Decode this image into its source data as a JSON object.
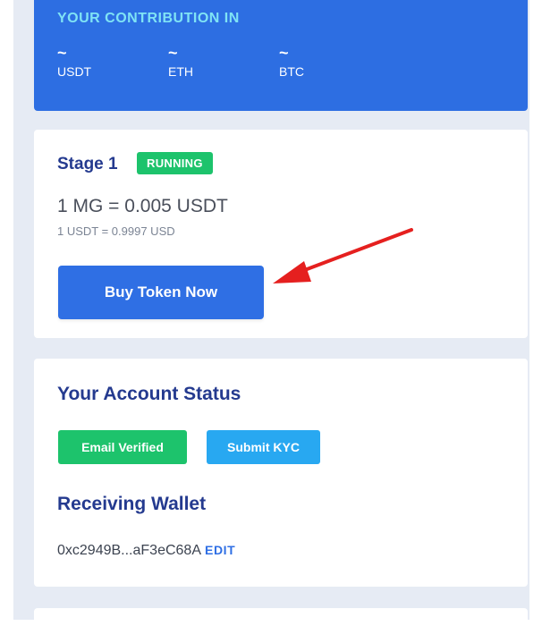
{
  "contribution": {
    "title": "YOUR CONTRIBUTION IN",
    "currencies": [
      {
        "amount": "~",
        "label": "USDT"
      },
      {
        "amount": "~",
        "label": "ETH"
      },
      {
        "amount": "~",
        "label": "BTC"
      }
    ]
  },
  "stage": {
    "title": "Stage 1",
    "status": "RUNNING",
    "price": "1 MG = 0.005 USDT",
    "rate": "1 USDT = 0.9997 USD",
    "buy_label": "Buy Token Now"
  },
  "account": {
    "title": "Your Account Status",
    "email_label": "Email Verified",
    "kyc_label": "Submit KYC",
    "wallet_title": "Receiving Wallet",
    "wallet_address": "0xc2949B...aF3eC68A",
    "edit_label": "EDIT"
  },
  "colors": {
    "accent": "#2f6fe4",
    "contrib_bg": "#2d6ee2",
    "heading": "#243a8f",
    "success": "#1dc36c",
    "info": "#28a8f1",
    "annotation_arrow": "#e5201f"
  }
}
